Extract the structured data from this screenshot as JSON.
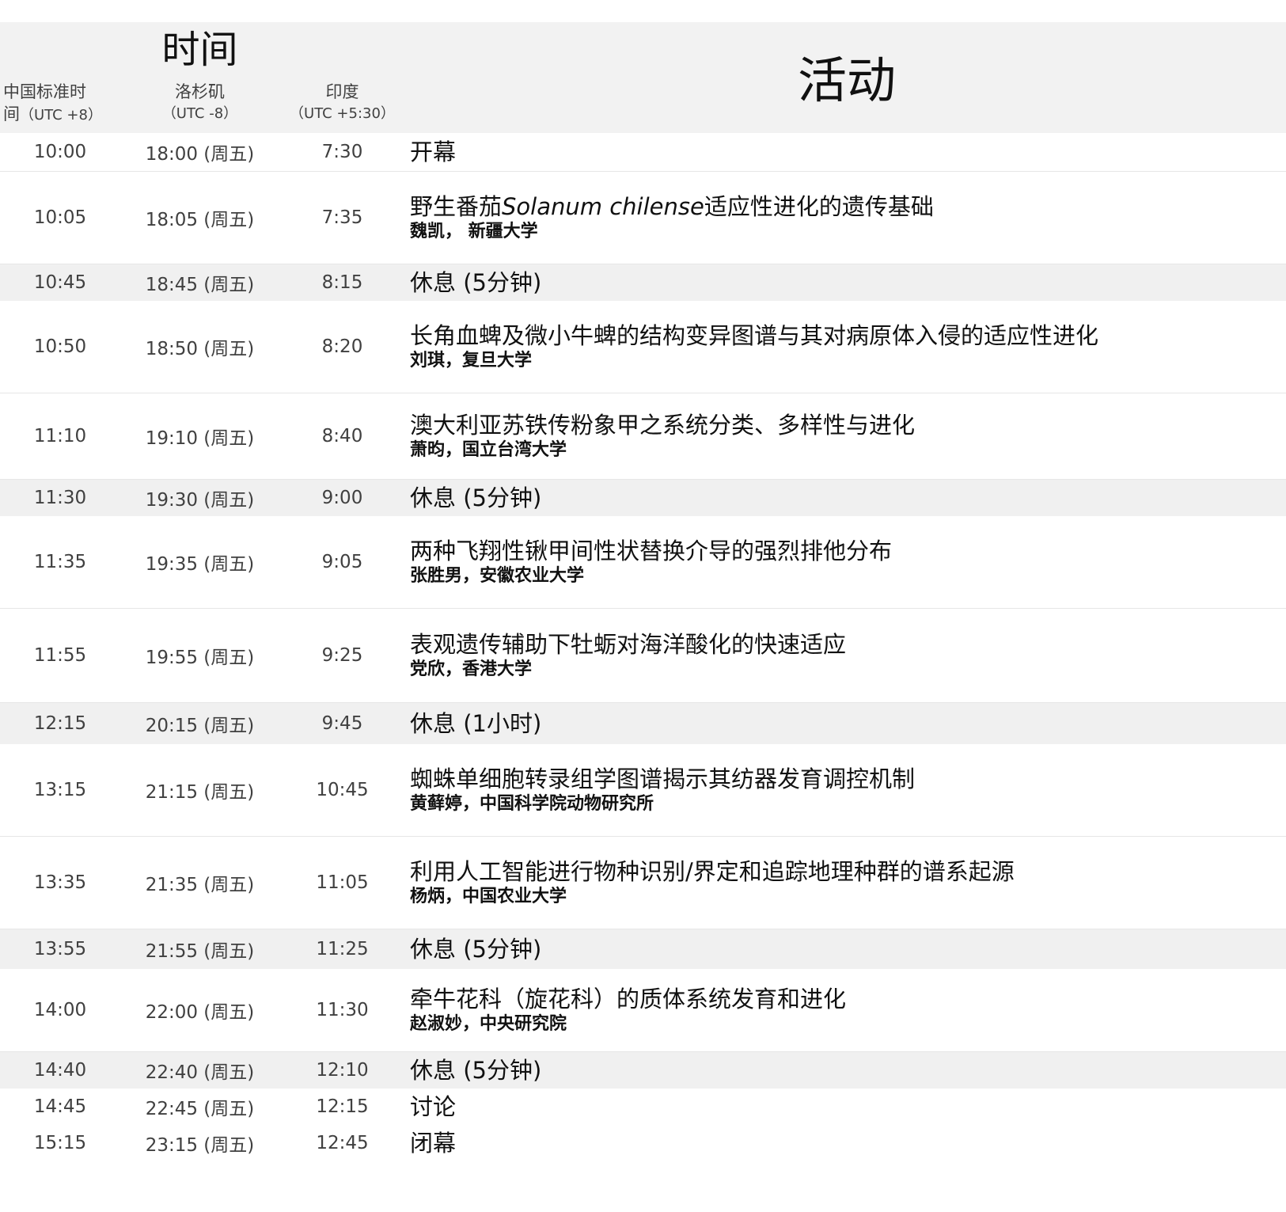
{
  "header": {
    "time_title": "时间",
    "activity_title": "活动",
    "china": {
      "name": "中国标准时间",
      "name_line1": "中国标准时",
      "name_line2": "间",
      "offset": "（UTC +8）"
    },
    "la": {
      "name": "洛杉矶",
      "offset": "（UTC -8）"
    },
    "india": {
      "name": "印度",
      "offset": "（UTC +5:30）"
    }
  },
  "rows": [
    {
      "china": "10:00",
      "la": "18:00 (周五)",
      "india": "7:30",
      "title": "开幕",
      "speaker": "",
      "is_break": false
    },
    {
      "china": "10:05",
      "la": "18:05 (周五)",
      "india": "7:35",
      "title_pre": "野生番茄",
      "title_italic": "Solanum chilense",
      "title_post": "适应性进化的遗传基础",
      "speaker": "魏凯， 新疆大学",
      "is_break": false
    },
    {
      "china": "10:45",
      "la": "18:45 (周五)",
      "india": "8:15",
      "title": "休息 (5分钟)",
      "speaker": "",
      "is_break": true
    },
    {
      "china": "10:50",
      "la": "18:50 (周五)",
      "india": "8:20",
      "title": "长角血蜱及微小牛蜱的结构变异图谱与其对病原体入侵的适应性进化",
      "speaker": "刘琪，复旦大学",
      "is_break": false
    },
    {
      "china": "11:10",
      "la": "19:10 (周五)",
      "india": "8:40",
      "title": "澳大利亚苏铁传粉象甲之系统分类、多样性与进化",
      "speaker": "萧昀，国立台湾大学",
      "is_break": false
    },
    {
      "china": "11:30",
      "la": "19:30 (周五)",
      "india": "9:00",
      "title": "休息 (5分钟)",
      "speaker": "",
      "is_break": true
    },
    {
      "china": "11:35",
      "la": "19:35 (周五)",
      "india": "9:05",
      "title": "两种飞翔性锹甲间性状替换介导的强烈排他分布",
      "speaker": "张胜男，安徽农业大学",
      "is_break": false
    },
    {
      "china": "11:55",
      "la": "19:55 (周五)",
      "india": "9:25",
      "title": "表观遗传辅助下牡蛎对海洋酸化的快速适应",
      "speaker": "党欣，香港大学",
      "is_break": false
    },
    {
      "china": "12:15",
      "la": "20:15 (周五)",
      "india": "9:45",
      "title": "休息 (1小时)",
      "speaker": "",
      "is_break": true
    },
    {
      "china": "13:15",
      "la": "21:15 (周五)",
      "india": "10:45",
      "title": "蜘蛛单细胞转录组学图谱揭示其纺器发育调控机制",
      "speaker": "黄藓婷，中国科学院动物研究所",
      "is_break": false
    },
    {
      "china": "13:35",
      "la": "21:35 (周五)",
      "india": "11:05",
      "title": "利用人工智能进行物种识别/界定和追踪地理种群的谱系起源",
      "speaker": "杨炳，中国农业大学",
      "is_break": false
    },
    {
      "china": "13:55",
      "la": "21:55 (周五)",
      "india": "11:25",
      "title": "休息 (5分钟)",
      "speaker": "",
      "is_break": true
    },
    {
      "china": "14:00",
      "la": "22:00 (周五)",
      "india": "11:30",
      "title": "牵牛花科（旋花科）的质体系统发育和进化",
      "speaker": "赵淑妙，中央研究院",
      "is_break": false
    },
    {
      "china": "14:40",
      "la": "22:40 (周五)",
      "india": "12:10",
      "title": "休息 (5分钟)",
      "speaker": "",
      "is_break": true
    },
    {
      "china": "14:45",
      "la": "22:45 (周五)",
      "india": "12:15",
      "title": "讨论",
      "speaker": "",
      "is_break": false
    },
    {
      "china": "15:15",
      "la": "23:15 (周五)",
      "india": "12:45",
      "title": "闭幕",
      "speaker": "",
      "is_break": false
    }
  ]
}
